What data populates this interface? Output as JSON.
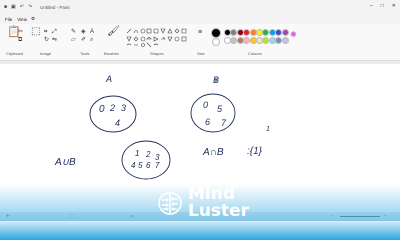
{
  "window": {
    "title": "Untitled - Paint"
  },
  "menu": {
    "file": "File",
    "view": "View"
  },
  "ribbon": {
    "groups": [
      "Clipboard",
      "Image",
      "Tools",
      "Brushes",
      "Shapes",
      "Size",
      "Colours"
    ],
    "colors": [
      "#000000",
      "#7f7f7f",
      "#880015",
      "#ed1c24",
      "#ff7f27",
      "#fff200",
      "#22b14c",
      "#00a2e8",
      "#3f48cc",
      "#a349a4",
      "#ffffff",
      "#c3c3c3",
      "#b97a57",
      "#ffaec9",
      "#ffc90e",
      "#efe4b0",
      "#b5e61d",
      "#99d9ea",
      "#7092be",
      "#c8bfe7"
    ]
  },
  "canvas": {
    "set_a_label": "A",
    "set_b_label": "B",
    "set_a_elements": [
      "0",
      "2",
      "3",
      "4"
    ],
    "set_b_elements": [
      "0",
      "5",
      "6",
      "7"
    ],
    "union_label": "A∪B",
    "union_elements": [
      "1",
      "2",
      "3",
      "4",
      "5",
      "6",
      "7"
    ],
    "intersection_label": "A∩B",
    "intersection_result": ":{1}",
    "side_mark": "1"
  },
  "brand": {
    "line1": "Mind",
    "line2": "Luster"
  }
}
